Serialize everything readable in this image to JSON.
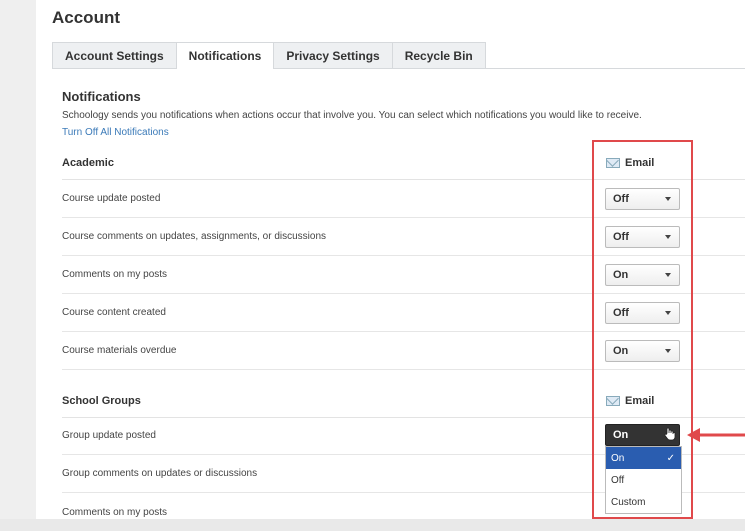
{
  "page_title": "Account",
  "tabs": [
    {
      "label": "Account Settings",
      "active": false
    },
    {
      "label": "Notifications",
      "active": true
    },
    {
      "label": "Privacy Settings",
      "active": false
    },
    {
      "label": "Recycle Bin",
      "active": false
    }
  ],
  "notifications": {
    "heading": "Notifications",
    "intro": "Schoology sends you notifications when actions occur that involve you. You can select which notifications you would like to receive.",
    "turn_off_link": "Turn Off All Notifications"
  },
  "academic": {
    "heading": "Academic",
    "column_label": "Email",
    "rows": [
      {
        "label": "Course update posted",
        "value": "Off"
      },
      {
        "label": "Course comments on updates, assignments, or discussions",
        "value": "Off"
      },
      {
        "label": "Comments on my posts",
        "value": "On"
      },
      {
        "label": "Course content created",
        "value": "Off"
      },
      {
        "label": "Course materials overdue",
        "value": "On"
      }
    ]
  },
  "school_groups": {
    "heading": "School Groups",
    "column_label": "Email",
    "rows": [
      {
        "label": "Group update posted",
        "value": "On"
      },
      {
        "label": "Group comments on updates or discussions",
        "value": ""
      },
      {
        "label": "Comments on my posts",
        "value": ""
      }
    ],
    "dropdown_options": [
      "On",
      "Off",
      "Custom"
    ],
    "dropdown_selected": "On"
  },
  "colors": {
    "accent": "#2a5db0",
    "highlight": "#e0494b",
    "link": "#3b7ab8"
  }
}
